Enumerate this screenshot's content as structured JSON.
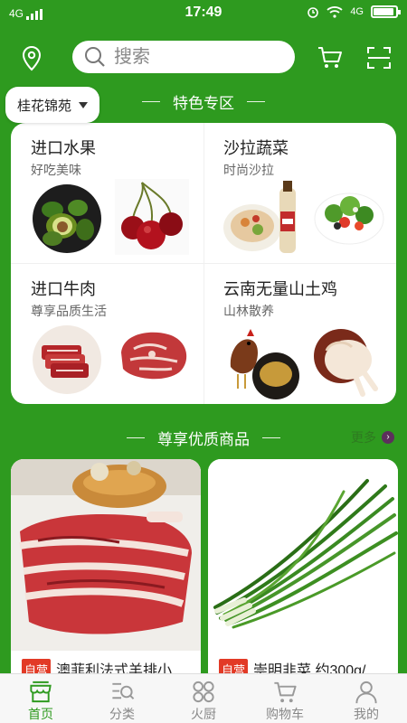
{
  "status_bar": {
    "network": "4G",
    "time": "17:49",
    "network_right": "4G"
  },
  "header": {
    "search_placeholder": "搜索"
  },
  "location": {
    "label": "桂花锦苑"
  },
  "featured": {
    "title": "特色专区",
    "cells": [
      {
        "title": "进口水果",
        "subtitle": "好吃美味"
      },
      {
        "title": "沙拉蔬菜",
        "subtitle": "时尚沙拉"
      },
      {
        "title": "进口牛肉",
        "subtitle": "尊享品质生活"
      },
      {
        "title": "云南无量山土鸡",
        "subtitle": "山林散养"
      }
    ]
  },
  "premium": {
    "title": "尊享优质商品",
    "more_label": "更多",
    "products": [
      {
        "tag": "自营",
        "name": "澳菲利法式羊排小"
      },
      {
        "tag": "自营",
        "name": "崇明韭菜 约300g/"
      }
    ]
  },
  "nav": {
    "items": [
      {
        "label": "首页",
        "icon": "shop-icon"
      },
      {
        "label": "分类",
        "icon": "category-icon"
      },
      {
        "label": "火厨",
        "icon": "grid-icon"
      },
      {
        "label": "购物车",
        "icon": "cart-icon"
      },
      {
        "label": "我的",
        "icon": "user-icon"
      }
    ]
  },
  "colors": {
    "brand_green": "#2e9a1f",
    "tag_red": "#e23a26"
  }
}
